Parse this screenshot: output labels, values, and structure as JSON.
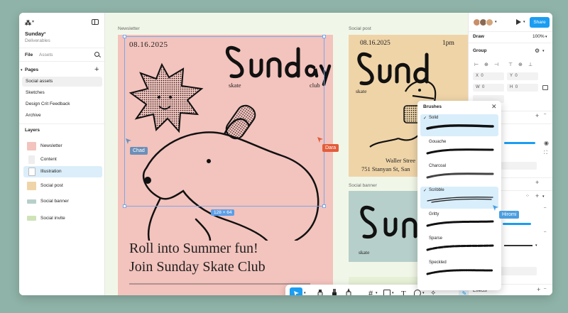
{
  "app": {
    "file_name": "Sunday",
    "file_subtitle": "Deliverables"
  },
  "left_panel": {
    "tabs": {
      "file": "File",
      "assets": "Assets"
    },
    "pages_title": "Pages",
    "pages": [
      "Social assets",
      "Sketches",
      "Design Crit Feedback",
      "Archive"
    ],
    "layers_title": "Layers",
    "layers": [
      "Newsletter",
      "Content",
      "Illustration",
      "Social post",
      "Social banner",
      "Social invite"
    ]
  },
  "canvas": {
    "frame_labels": {
      "newsletter": "Newsletter",
      "social_post": "Social post",
      "social_banner": "Social banner"
    },
    "newsletter": {
      "date": "08.16.2025",
      "skate": "skate",
      "club": "club",
      "headline_1": "Roll into Summer fun!",
      "headline_2": "Join Sunday Skate Club",
      "size_label": "128 × 64"
    },
    "social_post": {
      "date": "08.16.2025",
      "time": "1pm",
      "skate": "skate",
      "address_1": "Waller Stree",
      "address_2": "751 Stanyan St, San"
    },
    "social_banner": {
      "skate": "skate"
    },
    "cursors": {
      "chad": "Chad",
      "dara": "Dara",
      "hiromi": "Hiromi"
    },
    "cursor_colors": {
      "chad": "#6c8fb8",
      "dara": "#e25c3a",
      "hiromi": "#4a9ee0"
    }
  },
  "brushes": {
    "title": "Brushes",
    "items": [
      {
        "name": "Solid",
        "selected": true
      },
      {
        "name": "Gouache",
        "selected": false
      },
      {
        "name": "Charcoal",
        "selected": false
      },
      {
        "name": "Scribble",
        "selected": true
      },
      {
        "name": "Gritty",
        "selected": false
      },
      {
        "name": "Sparse",
        "selected": false
      },
      {
        "name": "Speckled",
        "selected": false
      }
    ]
  },
  "right_panel": {
    "share": "Share",
    "mode": "Draw",
    "zoom": "100%",
    "group_label": "Group",
    "x_label": "X",
    "x_value": "0",
    "y_label": "Y",
    "y_value": "0",
    "w_label": "W",
    "w_value": "0",
    "h_label": "H",
    "h_value": "0",
    "effects": "Effects"
  },
  "colors": {
    "accent": "#1b9df2",
    "selection": "#7aa7e8",
    "newsletter_bg": "#f3c3bd",
    "social_bg": "#efd4a8"
  }
}
